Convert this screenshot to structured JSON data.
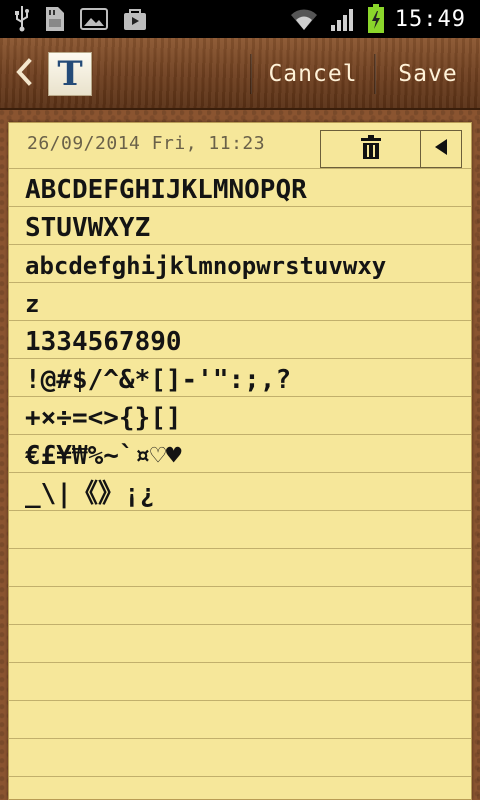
{
  "status_bar": {
    "time": "15:49",
    "icons": [
      "usb-icon",
      "sd-card-icon",
      "gallery-icon",
      "bag-icon",
      "wifi-icon",
      "signal-icon",
      "battery-charging-icon"
    ]
  },
  "action_bar": {
    "app_icon_letter": "T",
    "cancel_label": "Cancel",
    "save_label": "Save"
  },
  "note": {
    "date": "26/09/2014 Fri, 11:23",
    "lines": [
      "ABCDEFGHIJKLMNOPQR",
      "STUVWXYZ",
      "abcdefghijklmnopwrstuvwxy",
      "z",
      "1334567890",
      "!@#$/^&*[]-'\":;,?",
      "+×÷=<>{}[]",
      "€£¥₩%~`¤♡♥",
      "_\\|《》¡¿"
    ]
  },
  "colors": {
    "note_paper": "#f6e79a",
    "wood_bar": "#6e3f1f",
    "cork": "#8a5430"
  }
}
